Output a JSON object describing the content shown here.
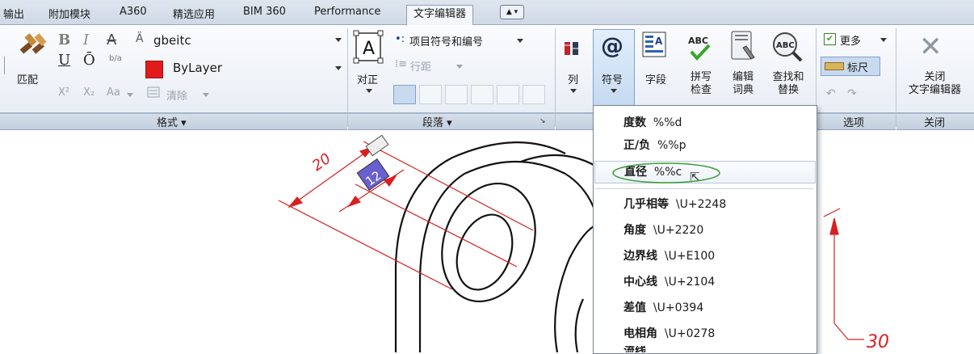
{
  "tabs": [
    {
      "label": "输出"
    },
    {
      "label": "附加模块"
    },
    {
      "label": "A360"
    },
    {
      "label": "精选应用"
    },
    {
      "label": "BIM 360"
    },
    {
      "label": "Performance"
    },
    {
      "label": "文字编辑器",
      "active": true
    }
  ],
  "format_panel": {
    "match_label": "匹配",
    "bold": "B",
    "italic": "I",
    "strike": "A",
    "underline": "U",
    "overline": "Ō",
    "stack": "b/a",
    "superscript": "X²",
    "subscript": "X₂",
    "case": "Aa",
    "font_value": "gbeitc",
    "color_value": "ByLayer",
    "color_swatch": "#e11b1b",
    "clear_label": "清除",
    "title": "格式"
  },
  "paragraph_panel": {
    "justify_label": "对正",
    "bullets_label": "项目符号和编号",
    "spacing_label": "行距",
    "title": "段落"
  },
  "insert_panel": {
    "column_label": "列",
    "symbol_label": "符号",
    "field_label": "字段"
  },
  "spell_panel": {
    "spellcheck_line1": "拼写",
    "spellcheck_line2": "检查",
    "dict_line1": "编辑",
    "dict_line2": "词典",
    "find_line1": "查找和",
    "find_line2": "替换"
  },
  "options_panel": {
    "more_label": "更多",
    "ruler_label": "标尺",
    "title": "选项"
  },
  "close_panel": {
    "line1": "关闭",
    "line2": "文字编辑器",
    "title": "关闭"
  },
  "symbol_menu": [
    {
      "name": "度数",
      "code": "%%d"
    },
    {
      "name": "正/负",
      "code": "%%p"
    },
    {
      "name": "直径",
      "code": "%%c",
      "highlighted": true
    },
    {
      "name": "几乎相等",
      "code": "\\U+2248"
    },
    {
      "name": "角度",
      "code": "\\U+2220"
    },
    {
      "name": "边界线",
      "code": "\\U+E100"
    },
    {
      "name": "中心线",
      "code": "\\U+2104"
    },
    {
      "name": "差值",
      "code": "\\U+0394"
    },
    {
      "name": "电相角",
      "code": "\\U+0278"
    },
    {
      "name": "流线",
      "code": ""
    }
  ],
  "drawing": {
    "dim_20": "20",
    "dim_12": "12",
    "dim_30": "30"
  }
}
